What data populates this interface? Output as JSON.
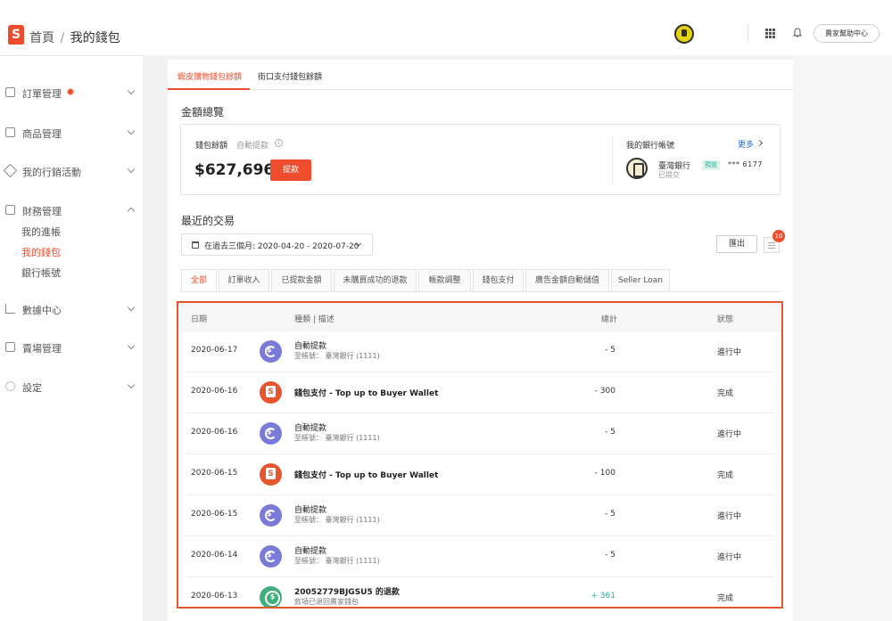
{
  "header": {
    "logo_letter": "S",
    "breadcrumb_home": "首頁",
    "breadcrumb_sep": "/",
    "breadcrumb_current": "我的錢包",
    "help_button": "賣家幫助中心"
  },
  "sidebar": {
    "items": [
      {
        "label": "訂單管理",
        "icon": "clipboard-icon"
      },
      {
        "label": "商品管理",
        "icon": "box-icon"
      },
      {
        "label": "我的行銷活動",
        "icon": "tag-icon"
      },
      {
        "label": "財務管理",
        "icon": "wallet-icon"
      },
      {
        "label": "數據中心",
        "icon": "chart-icon"
      },
      {
        "label": "賣場管理",
        "icon": "shop-icon"
      },
      {
        "label": "設定",
        "icon": "gear-icon"
      }
    ],
    "finance_sub": [
      "我的進帳",
      "我的錢包",
      "銀行帳號"
    ]
  },
  "wallet_tabs": [
    "蝦皮購物錢包餘額",
    "街口支付錢包餘額"
  ],
  "overview": {
    "title": "金額總覽",
    "balance_label": "錢包餘額",
    "auto_withdraw": "自動提款",
    "info_glyph": "i",
    "balance": "$627,696",
    "withdraw_button": "提款",
    "bank_title": "我的銀行帳號",
    "more_link": "更多",
    "bank_name": "臺灣銀行",
    "bank_status": "已提交",
    "default_badge": "預設",
    "account_mask": "*** 6177"
  },
  "transactions": {
    "title": "最近的交易",
    "date_range": "在過去三個月: 2020-04-20 - 2020-07-20",
    "export_button": "匯出",
    "badge_count": "10",
    "filter_tabs": [
      "全部",
      "訂單收入",
      "已提款金額",
      "未購買成功的退款",
      "帳款調整",
      "錢包支付",
      "廣告金額自動儲值",
      "Seller Loan"
    ],
    "columns": {
      "date": "日期",
      "type": "種類 | 描述",
      "amount": "總計",
      "status": "狀態"
    },
    "rows": [
      {
        "date": "2020-06-17",
        "kind": "withdraw",
        "title": "自動提款",
        "sub": "至帳號： 臺灣銀行 (1111)",
        "amount": "- 5",
        "status": "進行中"
      },
      {
        "date": "2020-06-16",
        "kind": "wallet",
        "title": "錢包支付 - Top up to Buyer Wallet",
        "sub": "",
        "amount": "- 300",
        "status": "完成"
      },
      {
        "date": "2020-06-16",
        "kind": "withdraw",
        "title": "自動提款",
        "sub": "至帳號： 臺灣銀行 (1111)",
        "amount": "- 5",
        "status": "進行中"
      },
      {
        "date": "2020-06-15",
        "kind": "wallet",
        "title": "錢包支付 - Top up to Buyer Wallet",
        "sub": "",
        "amount": "- 100",
        "status": "完成"
      },
      {
        "date": "2020-06-15",
        "kind": "withdraw",
        "title": "自動提款",
        "sub": "至帳號： 臺灣銀行 (1111)",
        "amount": "- 5",
        "status": "進行中"
      },
      {
        "date": "2020-06-14",
        "kind": "withdraw",
        "title": "自動提款",
        "sub": "至帳號： 臺灣銀行 (1111)",
        "amount": "- 5",
        "status": "進行中"
      },
      {
        "date": "2020-06-13",
        "kind": "refund",
        "title": "20052779BJGSU5 的退款",
        "sub": "款項已退回賣家錢包",
        "amount": "+ 361",
        "status": "完成"
      }
    ]
  },
  "colors": {
    "accent": "#ee4d2d",
    "positive": "#26aa99",
    "link": "#1b6fd6"
  }
}
